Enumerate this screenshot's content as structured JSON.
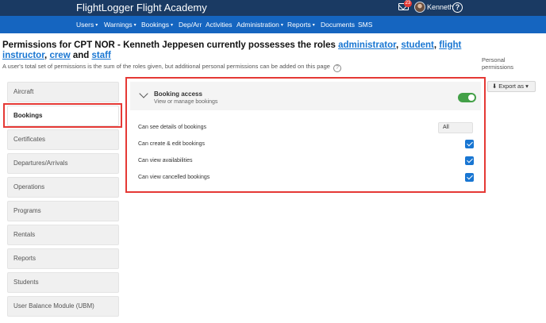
{
  "app": {
    "brand": "FlightLogger Flight Academy",
    "notification_count": "23",
    "username": "Kenneth",
    "help_icon": "question-circle-icon"
  },
  "nav": {
    "items": [
      {
        "label": "Users",
        "dropdown": true
      },
      {
        "label": "Warnings",
        "dropdown": true
      },
      {
        "label": "Bookings",
        "dropdown": true
      },
      {
        "label": "Dep/Arr",
        "dropdown": false
      },
      {
        "label": "Activities",
        "dropdown": false
      },
      {
        "label": "Administration",
        "dropdown": true
      },
      {
        "label": "Reports",
        "dropdown": true
      },
      {
        "label": "Documents",
        "dropdown": false
      },
      {
        "label": "SMS",
        "dropdown": false
      }
    ],
    "caret": "▾"
  },
  "header": {
    "title_prefix": "Permissions for CPT NOR - Kenneth Jeppesen currently possesses the roles ",
    "roles": [
      "administrator",
      "student",
      "flight instructor",
      "crew",
      "staff"
    ],
    "sep_comma": ", ",
    "sep_and": " and ",
    "subtitle": "A user's total set of permissions is the sum of the roles given, but additional personal permissions can be added on this page",
    "help_glyph": "?",
    "personal_permissions": "Personal permissions",
    "export_label": "Export as",
    "export_caret": "▾",
    "download_glyph": "⬇"
  },
  "sidebar": {
    "items": [
      {
        "label": "Aircraft",
        "active": false
      },
      {
        "label": "Bookings",
        "active": true
      },
      {
        "label": "Certificates",
        "active": false
      },
      {
        "label": "Departures/Arrivals",
        "active": false
      },
      {
        "label": "Operations",
        "active": false
      },
      {
        "label": "Programs",
        "active": false
      },
      {
        "label": "Rentals",
        "active": false
      },
      {
        "label": "Reports",
        "active": false
      },
      {
        "label": "Students",
        "active": false
      },
      {
        "label": "User Balance Module (UBM)",
        "active": false
      }
    ]
  },
  "panel": {
    "title": "Booking access",
    "subtitle": "View or manage bookings",
    "toggle_on": true,
    "permissions": [
      {
        "label": "Can see details of bookings",
        "type": "select",
        "value": "All"
      },
      {
        "label": "Can create & edit bookings",
        "type": "checkbox",
        "checked": true
      },
      {
        "label": "Can view availabilities",
        "type": "checkbox",
        "checked": true
      },
      {
        "label": "Can view cancelled bookings",
        "type": "checkbox",
        "checked": true
      }
    ]
  },
  "colors": {
    "topbar": "#1a3a63",
    "navbar": "#1565c0",
    "link": "#1976d2",
    "highlight": "#e53935",
    "toggle_on": "#43a047",
    "checkbox": "#1976d2"
  }
}
